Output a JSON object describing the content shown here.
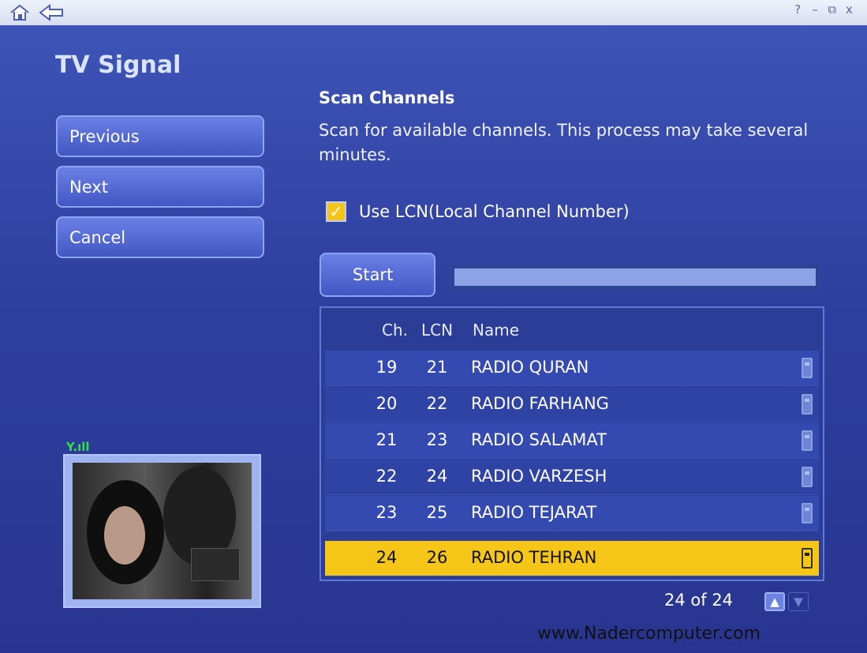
{
  "window": {
    "controls": [
      "?",
      "–",
      "⧉",
      "x"
    ]
  },
  "page_title": "TV Signal",
  "nav_buttons": [
    {
      "label": "Previous"
    },
    {
      "label": "Next"
    },
    {
      "label": "Cancel"
    }
  ],
  "scan": {
    "title": "Scan Channels",
    "description": "Scan for available channels. This process may take several minutes.",
    "lcn_label": "Use LCN(Local Channel Number)",
    "lcn_checked": true,
    "start_label": "Start",
    "progress": 1.0
  },
  "channel_list": {
    "headers": {
      "ch": "Ch.",
      "lcn": "LCN",
      "name": "Name"
    },
    "rows": [
      {
        "ch": "19",
        "lcn": "21",
        "name": "RADIO QURAN",
        "selected": false
      },
      {
        "ch": "20",
        "lcn": "22",
        "name": "RADIO FARHANG",
        "selected": false
      },
      {
        "ch": "21",
        "lcn": "23",
        "name": "RADIO SALAMAT",
        "selected": false
      },
      {
        "ch": "22",
        "lcn": "24",
        "name": "RADIO VARZESH",
        "selected": false
      },
      {
        "ch": "23",
        "lcn": "25",
        "name": "RADIO TEJARAT",
        "selected": false
      },
      {
        "ch": "24",
        "lcn": "26",
        "name": "RADIO TEHRAN",
        "selected": true
      }
    ],
    "pager": "24 of 24"
  },
  "signal_indicator": "Y.ıll",
  "watermark": "www.Nadercomputer.com",
  "colors": {
    "accent": "#f5c518",
    "background": "#3f56b8"
  }
}
